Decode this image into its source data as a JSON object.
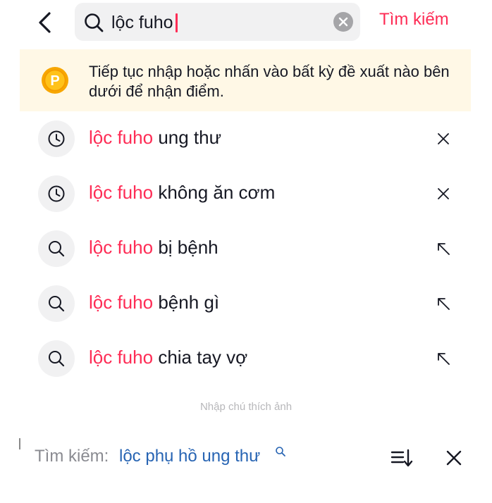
{
  "header": {
    "query": "lộc fuho",
    "search_button_label": "Tìm kiếm",
    "accent_color": "#fe2c55"
  },
  "banner": {
    "coin_letter": "P",
    "message": "Tiếp tục nhập hoặc nhấn vào bất kỳ đề xuất nào bên dưới để nhận điểm."
  },
  "suggestions": [
    {
      "icon": "history-clock-icon",
      "prefix": "lộc fuho",
      "rest": "ung thư",
      "action": "remove-x-icon"
    },
    {
      "icon": "history-clock-icon",
      "prefix": "lộc fuho",
      "rest": "không ăn cơm",
      "action": "remove-x-icon"
    },
    {
      "icon": "search-icon",
      "prefix": "lộc fuho",
      "rest": "bị bệnh",
      "action": "fill-arrow-icon"
    },
    {
      "icon": "search-icon",
      "prefix": "lộc fuho",
      "rest": "bệnh gì",
      "action": "fill-arrow-icon"
    },
    {
      "icon": "search-icon",
      "prefix": "lộc fuho",
      "rest": "chia tay vợ",
      "action": "fill-arrow-icon"
    }
  ],
  "caption": "Nhập chú thích ảnh",
  "bottom_bar": {
    "label": "Tìm kiếm:",
    "term": "lộc phụ hồ ung thư",
    "term_color": "#2764b3"
  }
}
